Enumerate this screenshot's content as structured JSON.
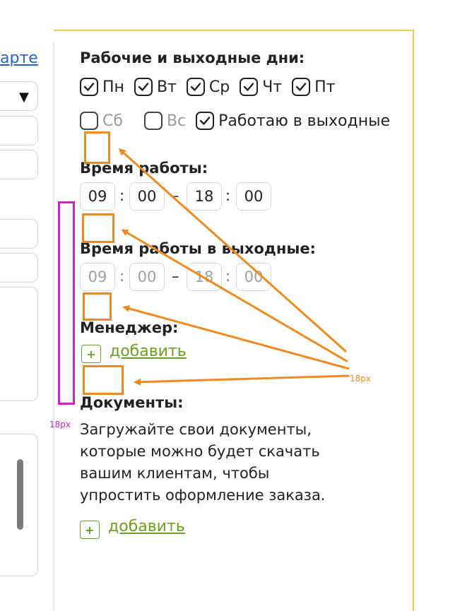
{
  "left_column": {
    "link_partial": "арте",
    "select_caret": "▼"
  },
  "work_days": {
    "title": "Рабочие и выходные дни:",
    "days": [
      {
        "label": "Пн",
        "checked": true
      },
      {
        "label": "Вт",
        "checked": true
      },
      {
        "label": "Ср",
        "checked": true
      },
      {
        "label": "Чт",
        "checked": true
      },
      {
        "label": "Пт",
        "checked": true
      },
      {
        "label": "Сб",
        "checked": false
      },
      {
        "label": "Вс",
        "checked": false
      }
    ],
    "weekend_work_label": "Работаю в выходные",
    "weekend_work_checked": true
  },
  "work_time": {
    "title": "Время работы:",
    "start_hour": "09",
    "start_min": "00",
    "end_hour": "18",
    "end_min": "00",
    "colon": ":",
    "dash": "–"
  },
  "weekend_time": {
    "title": "Время работы в выходные:",
    "start_hour": "09",
    "start_min": "00",
    "end_hour": "18",
    "end_min": "00",
    "colon": ":",
    "dash": "–"
  },
  "manager": {
    "title": "Менеджер:",
    "add_icon": "+",
    "add_label": "добавить"
  },
  "documents": {
    "title": "Документы:",
    "description": "Загружайте свои документы, которые можно будет скачать вашим клиентам, чтобы упростить оформление заказа.",
    "add_icon": "+",
    "add_label": "добавить"
  },
  "annotations": {
    "orange_label": "18px",
    "magenta_label": "18px"
  },
  "colors": {
    "accent_yellow": "#f2c84b",
    "add_green": "#6aa01f",
    "annotation_orange": "#f08a1e",
    "annotation_magenta": "#d21fbf"
  }
}
